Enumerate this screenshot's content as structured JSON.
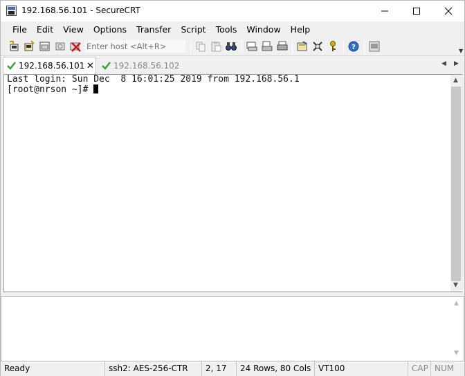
{
  "window": {
    "title": "192.168.56.101 - SecureCRT"
  },
  "menu": [
    "File",
    "Edit",
    "View",
    "Options",
    "Transfer",
    "Script",
    "Tools",
    "Window",
    "Help"
  ],
  "toolbar": {
    "host_placeholder": "Enter host <Alt+R>"
  },
  "tabs": [
    {
      "label": "192.168.56.101",
      "active": true,
      "connected": true
    },
    {
      "label": "192.168.56.102",
      "active": false,
      "connected": true
    }
  ],
  "terminal": {
    "lines": [
      "Last login: Sun Dec  8 16:01:25 2019 from 192.168.56.1",
      "[root@nrson ~]# "
    ]
  },
  "status": {
    "ready": "Ready",
    "cipher": "ssh2: AES-256-CTR",
    "position": "2,  17",
    "size": "24 Rows, 80 Cols",
    "emulation": "VT100",
    "cap": "CAP",
    "num": "NUM"
  },
  "colors": {
    "accent": "#2f6fc7",
    "check": "#3aa13a",
    "inactive_tab_text": "#8a8a8a"
  }
}
